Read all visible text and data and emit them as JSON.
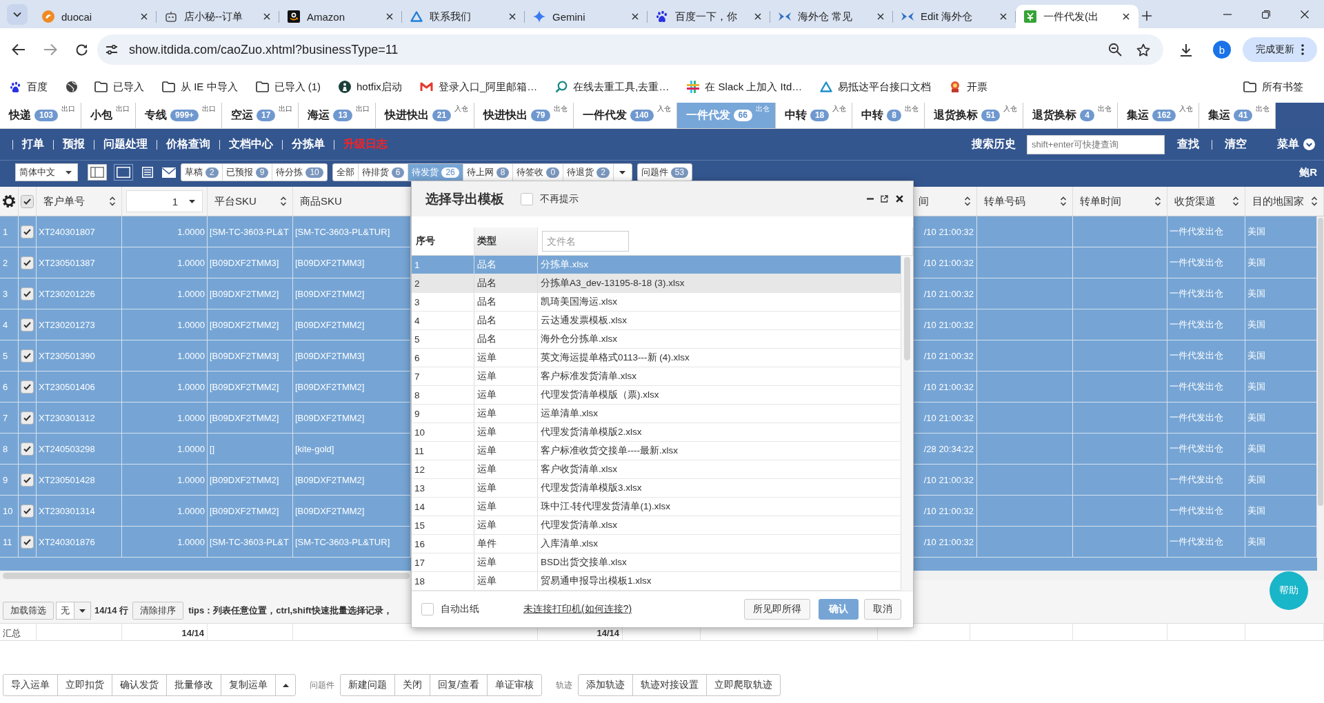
{
  "browser": {
    "tabs": [
      {
        "title": "duocai",
        "selected": false
      },
      {
        "title": "店小秘--订单",
        "selected": false
      },
      {
        "title": "Amazon",
        "selected": false
      },
      {
        "title": "联系我们",
        "selected": false
      },
      {
        "title": "Gemini",
        "selected": false
      },
      {
        "title": "百度一下，你",
        "selected": false
      },
      {
        "title": "海外仓 常见",
        "selected": false
      },
      {
        "title": "Edit 海外仓",
        "selected": false
      },
      {
        "title": "一件代发(出",
        "selected": true
      }
    ],
    "url": "show.itdida.com/caoZuo.xhtml?businessType=11",
    "profile": "b",
    "update_button": "完成更新",
    "bookmarks": [
      {
        "label": "百度"
      },
      {
        "label": "已导入"
      },
      {
        "label": "从 IE 中导入"
      },
      {
        "label": "已导入 (1)"
      },
      {
        "label": "hotfix启动"
      },
      {
        "label": "登录入口_阿里邮箱…"
      },
      {
        "label": "在线去重工具,去重…"
      },
      {
        "label": "在 Slack 上加入 Itd…"
      },
      {
        "label": "易抵达平台接口文档"
      },
      {
        "label": "开票"
      }
    ],
    "all_bookmarks": "所有书签"
  },
  "app_tabs": [
    {
      "label": "快递",
      "count": "103",
      "tag": "出口",
      "selected": false
    },
    {
      "label": "小包",
      "tag": "出口",
      "selected": false
    },
    {
      "label": "专线",
      "count": "999+",
      "tag": "出口",
      "selected": false
    },
    {
      "label": "空运",
      "count": "17",
      "tag": "出口",
      "selected": false
    },
    {
      "label": "海运",
      "count": "13",
      "tag": "出口",
      "selected": false
    },
    {
      "label": "快进快出",
      "count": "21",
      "tag": "入仓",
      "selected": false
    },
    {
      "label": "快进快出",
      "count": "79",
      "tag": "出仓",
      "selected": false
    },
    {
      "label": "一件代发",
      "count": "140",
      "tag": "入仓",
      "selected": false
    },
    {
      "label": "一件代发",
      "count": "66",
      "tag": "出仓",
      "selected": true
    },
    {
      "label": "中转",
      "count": "18",
      "tag": "入仓",
      "selected": false
    },
    {
      "label": "中转",
      "count": "8",
      "tag": "出仓",
      "selected": false
    },
    {
      "label": "退货换标",
      "count": "51",
      "tag": "入仓",
      "selected": false
    },
    {
      "label": "退货换标",
      "count": "4",
      "tag": "出仓",
      "selected": false
    },
    {
      "label": "集运",
      "count": "162",
      "tag": "入仓",
      "selected": false
    },
    {
      "label": "集运",
      "count": "41",
      "tag": "出仓",
      "selected": false
    }
  ],
  "menu": {
    "items": [
      {
        "label": "打单",
        "highlighted": false
      },
      {
        "label": "预报",
        "highlighted": false
      },
      {
        "label": "问题处理",
        "highlighted": false
      },
      {
        "label": "价格查询",
        "highlighted": false
      },
      {
        "label": "文档中心",
        "highlighted": false
      },
      {
        "label": "分拣单",
        "highlighted": false
      },
      {
        "label": "升级日志",
        "highlighted": true
      }
    ],
    "search_history": "搜索历史",
    "search": {
      "placeholder": "shift+enter可快捷查询"
    },
    "find": "查找",
    "clear": "清空",
    "menu_button": "菜单"
  },
  "filter_bar": {
    "language": "简体中文",
    "groups": [
      {
        "items": [
          {
            "label": "草稿",
            "count": "2",
            "selected": false
          },
          {
            "label": "已预报",
            "count": "9",
            "selected": false
          },
          {
            "label": "待分拣",
            "count": "10",
            "selected": false
          }
        ],
        "dropdown": false
      },
      {
        "items": [
          {
            "label": "全部",
            "selected": false
          },
          {
            "label": "待排货",
            "count": "6",
            "selected": false
          },
          {
            "label": "待发货",
            "count": "26",
            "selected": true
          },
          {
            "label": "待上网",
            "count": "8",
            "selected": false
          },
          {
            "label": "待签收",
            "count": "0",
            "selected": false
          },
          {
            "label": "待退货",
            "count": "2",
            "selected": false
          }
        ],
        "dropdown": true
      },
      {
        "items": [
          {
            "label": "问题件",
            "count": "53",
            "selected": false
          }
        ],
        "dropdown": false
      }
    ],
    "user": "鲍R"
  },
  "table": {
    "select_all_checked": true,
    "columns": [
      {
        "kind": "label",
        "label": "客户单号",
        "sortable": true
      },
      {
        "kind": "filter",
        "value": "1"
      },
      {
        "kind": "label",
        "label": "平台SKU",
        "sortable": true
      },
      {
        "kind": "label",
        "label": "商品SKU",
        "sortable": false
      },
      {
        "kind": "label",
        "label": "间",
        "sortable": true
      },
      {
        "kind": "label",
        "label": "转单号码",
        "sortable": true
      },
      {
        "kind": "label",
        "label": "转单时间",
        "sortable": true
      },
      {
        "kind": "label",
        "label": "收货渠道",
        "sortable": true
      },
      {
        "kind": "label",
        "label": "目的地国家",
        "sortable": true
      }
    ],
    "rows": [
      {
        "no": "1",
        "checked": true,
        "selected": true,
        "customer_order_no": "XT240301807",
        "column_2": "1.0000",
        "platform_sku": "[SM-TC-3603-PL&T",
        "product_sku": "[SM-TC-3603-PL&TUR]",
        "column_5": "/10 21:00:32",
        "channel": "一件代发出仓",
        "country": "美国"
      },
      {
        "no": "2",
        "checked": true,
        "selected": true,
        "customer_order_no": "XT230501387",
        "column_2": "1.0000",
        "platform_sku": "[B09DXF2TMM3]",
        "product_sku": "[B09DXF2TMM3]",
        "column_5": "/10 21:00:32",
        "channel": "一件代发出仓",
        "country": "美国"
      },
      {
        "no": "3",
        "checked": true,
        "selected": true,
        "customer_order_no": "XT230201226",
        "column_2": "1.0000",
        "platform_sku": "[B09DXF2TMM2]",
        "product_sku": "[B09DXF2TMM2]",
        "column_5": "/10 21:00:32",
        "channel": "一件代发出仓",
        "country": "美国"
      },
      {
        "no": "4",
        "checked": true,
        "selected": true,
        "customer_order_no": "XT230201273",
        "column_2": "1.0000",
        "platform_sku": "[B09DXF2TMM2]",
        "product_sku": "[B09DXF2TMM2]",
        "column_5": "/10 21:00:32",
        "channel": "一件代发出仓",
        "country": "美国"
      },
      {
        "no": "5",
        "checked": true,
        "selected": true,
        "customer_order_no": "XT230501390",
        "column_2": "1.0000",
        "platform_sku": "[B09DXF2TMM3]",
        "product_sku": "[B09DXF2TMM3]",
        "column_5": "/10 21:00:32",
        "channel": "一件代发出仓",
        "country": "美国"
      },
      {
        "no": "6",
        "checked": true,
        "selected": true,
        "customer_order_no": "XT230501406",
        "column_2": "1.0000",
        "platform_sku": "[B09DXF2TMM2]",
        "product_sku": "[B09DXF2TMM2]",
        "column_5": "/10 21:00:32",
        "channel": "一件代发出仓",
        "country": "美国"
      },
      {
        "no": "7",
        "checked": true,
        "selected": true,
        "customer_order_no": "XT230301312",
        "column_2": "1.0000",
        "platform_sku": "[B09DXF2TMM2]",
        "product_sku": "[B09DXF2TMM2]",
        "column_5": "/10 21:00:32",
        "channel": "一件代发出仓",
        "country": "美国"
      },
      {
        "no": "8",
        "checked": true,
        "selected": true,
        "customer_order_no": "XT240503298",
        "column_2": "1.0000",
        "platform_sku": "[]",
        "product_sku": "[kite-gold]",
        "column_5": "/28 20:34:22",
        "channel": "一件代发出仓",
        "country": "美国"
      },
      {
        "no": "9",
        "checked": true,
        "selected": true,
        "customer_order_no": "XT230501428",
        "column_2": "1.0000",
        "platform_sku": "[B09DXF2TMM2]",
        "product_sku": "[B09DXF2TMM2]",
        "column_5": "/10 21:00:32",
        "channel": "一件代发出仓",
        "country": "美国"
      },
      {
        "no": "10",
        "checked": true,
        "selected": true,
        "customer_order_no": "XT230301314",
        "column_2": "1.0000",
        "platform_sku": "[B09DXF2TMM2]",
        "product_sku": "[B09DXF2TMM2]",
        "column_5": "/10 21:00:32",
        "channel": "一件代发出仓",
        "country": "美国"
      },
      {
        "no": "11",
        "checked": true,
        "selected": true,
        "customer_order_no": "XT240301876",
        "column_2": "1.0000",
        "platform_sku": "[SM-TC-3603-PL&T",
        "product_sku": "[SM-TC-3603-PL&TUR]",
        "column_5": "/10 21:00:32",
        "channel": "一件代发出仓",
        "country": "美国"
      }
    ]
  },
  "status_bar": {
    "load_filter": "加载筛选",
    "filter_select": "无",
    "row_count": "14/14 行",
    "clear_sort": "清除排序",
    "tips": "tips：列表任意位置，ctrl,shift快速批量选择记录，"
  },
  "summary": {
    "label": "汇总",
    "totals": [
      "14/14",
      "14/14"
    ]
  },
  "export_dialog": {
    "title": "选择导出模板",
    "dont_show_again": {
      "label": "不再提示",
      "checked": false
    },
    "columns": [
      "序号",
      "类型"
    ],
    "filename_filter": {
      "placeholder": "文件名"
    },
    "templates": [
      {
        "no": "1",
        "type": "品名",
        "file": "分拣单.xlsx",
        "selected": true,
        "hovered": false
      },
      {
        "no": "2",
        "type": "品名",
        "file": "分拣单A3_dev-13195-8-18 (3).xlsx",
        "selected": false,
        "hovered": true
      },
      {
        "no": "3",
        "type": "品名",
        "file": "凯琦美国海运.xlsx",
        "selected": false,
        "hovered": false
      },
      {
        "no": "4",
        "type": "品名",
        "file": "云达通发票模板.xlsx",
        "selected": false,
        "hovered": false
      },
      {
        "no": "5",
        "type": "品名",
        "file": "海外仓分拣单.xlsx",
        "selected": false,
        "hovered": false
      },
      {
        "no": "6",
        "type": "运单",
        "file": "英文海运提单格式0113---新 (4).xlsx",
        "selected": false,
        "hovered": false
      },
      {
        "no": "7",
        "type": "运单",
        "file": "客户标准发货清单.xlsx",
        "selected": false,
        "hovered": false
      },
      {
        "no": "8",
        "type": "运单",
        "file": "代理发货清单模版（票).xlsx",
        "selected": false,
        "hovered": false
      },
      {
        "no": "9",
        "type": "运单",
        "file": "运单清单.xlsx",
        "selected": false,
        "hovered": false
      },
      {
        "no": "10",
        "type": "运单",
        "file": "代理发货清单模版2.xlsx",
        "selected": false,
        "hovered": false
      },
      {
        "no": "11",
        "type": "运单",
        "file": "客户标准收货交接单----最新.xlsx",
        "selected": false,
        "hovered": false
      },
      {
        "no": "12",
        "type": "运单",
        "file": "客户收货清单.xlsx",
        "selected": false,
        "hovered": false
      },
      {
        "no": "13",
        "type": "运单",
        "file": "代理发货清单模版3.xlsx",
        "selected": false,
        "hovered": false
      },
      {
        "no": "14",
        "type": "运单",
        "file": "珠中江-转代理发货清单(1).xlsx",
        "selected": false,
        "hovered": false
      },
      {
        "no": "15",
        "type": "运单",
        "file": "代理发货清单.xlsx",
        "selected": false,
        "hovered": false
      },
      {
        "no": "16",
        "type": "单件",
        "file": "入库清单.xlsx",
        "selected": false,
        "hovered": false
      },
      {
        "no": "17",
        "type": "运单",
        "file": "BSD出货交接单.xlsx",
        "selected": false,
        "hovered": false
      },
      {
        "no": "18",
        "type": "运单",
        "file": "贸易通申报导出模板1.xlsx",
        "selected": false,
        "hovered": false
      }
    ],
    "auto_print": {
      "label": "自动出纸",
      "checked": false
    },
    "printer_link": "未连接打印机(如何连接?)",
    "buttons": [
      {
        "label": "所见即所得",
        "kind": "default"
      },
      {
        "label": "确认",
        "kind": "primary"
      },
      {
        "label": "取消",
        "kind": "default"
      }
    ]
  },
  "help_button": "帮助",
  "bottom_toolbar": {
    "groups": [
      {
        "buttons": [
          "导入运单",
          "立即扣货",
          "确认发货",
          "批量修改",
          "复制运单"
        ],
        "more_button": true
      },
      {
        "label": "问题件",
        "buttons": [
          "新建问题",
          "关闭",
          "回复/查看",
          "单证审核"
        ],
        "more_button": false
      },
      {
        "label": "轨迹",
        "buttons": [
          "添加轨迹",
          "轨迹对接设置",
          "立即爬取轨迹"
        ],
        "more_button": false
      }
    ]
  }
}
